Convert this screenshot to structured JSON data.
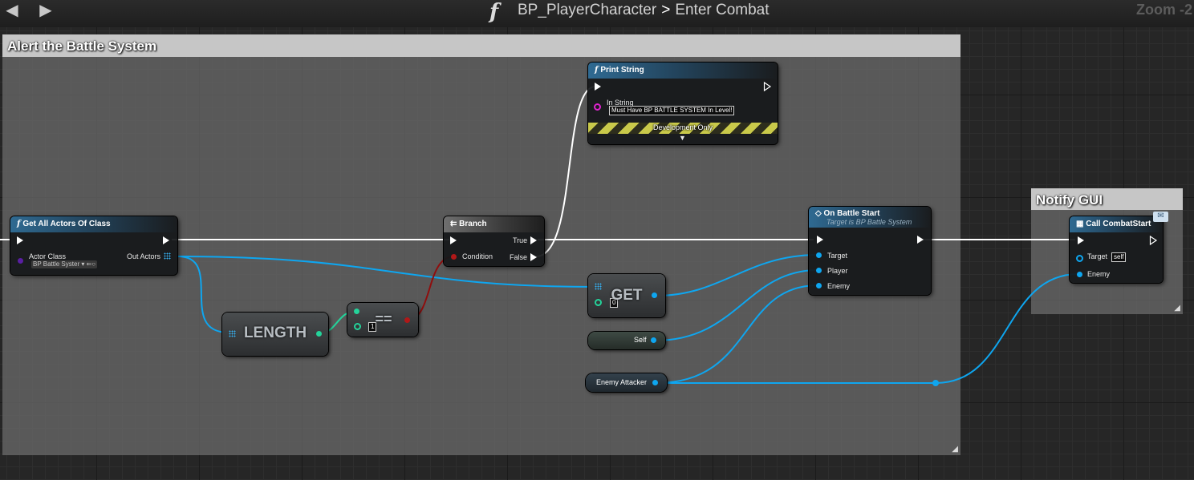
{
  "header": {
    "function_icon": "f",
    "breadcrumb_parent": "BP_PlayerCharacter",
    "breadcrumb_separator": ">",
    "breadcrumb_current": "Enter Combat",
    "zoom": "Zoom -2",
    "back_icon": "arrow-left",
    "forward_icon": "arrow-right"
  },
  "comments": {
    "alert": "Alert the Battle System",
    "notify": "Notify GUI"
  },
  "nodes": {
    "get_all_actors": {
      "title": "Get All Actors Of Class",
      "icon": "f",
      "actor_class_label": "Actor Class",
      "actor_class_value": "BP Battle Syster",
      "out_actors_label": "Out Actors"
    },
    "length": {
      "label": "LENGTH"
    },
    "equals": {
      "label": "==",
      "b_value": "1"
    },
    "branch": {
      "title": "Branch",
      "condition_label": "Condition",
      "true_label": "True",
      "false_label": "False"
    },
    "print_string": {
      "title": "Print String",
      "icon": "f",
      "in_string_label": "In String",
      "in_string_value": "Must Have BP BATTLE SYSTEM In Level!",
      "dev_only_label": "Development Only"
    },
    "get": {
      "label": "GET",
      "index_value": "0"
    },
    "self": {
      "label": "Self"
    },
    "enemy_attacker": {
      "label": "Enemy Attacker"
    },
    "on_battle_start": {
      "title": "On Battle Start",
      "subtitle": "Target is BP Battle System",
      "target_label": "Target",
      "player_label": "Player",
      "enemy_label": "Enemy"
    },
    "call_combat_start": {
      "title": "Call CombatStart",
      "target_label": "Target",
      "target_value": "self",
      "enemy_label": "Enemy"
    }
  },
  "colors": {
    "exec_wire": "#ffffff",
    "object_wire": "#0ea6f0",
    "int_wire": "#24d39a",
    "bool_wire": "#8f0e0e",
    "class_pin": "#5a1fa3",
    "string_pin": "#e024d0"
  }
}
